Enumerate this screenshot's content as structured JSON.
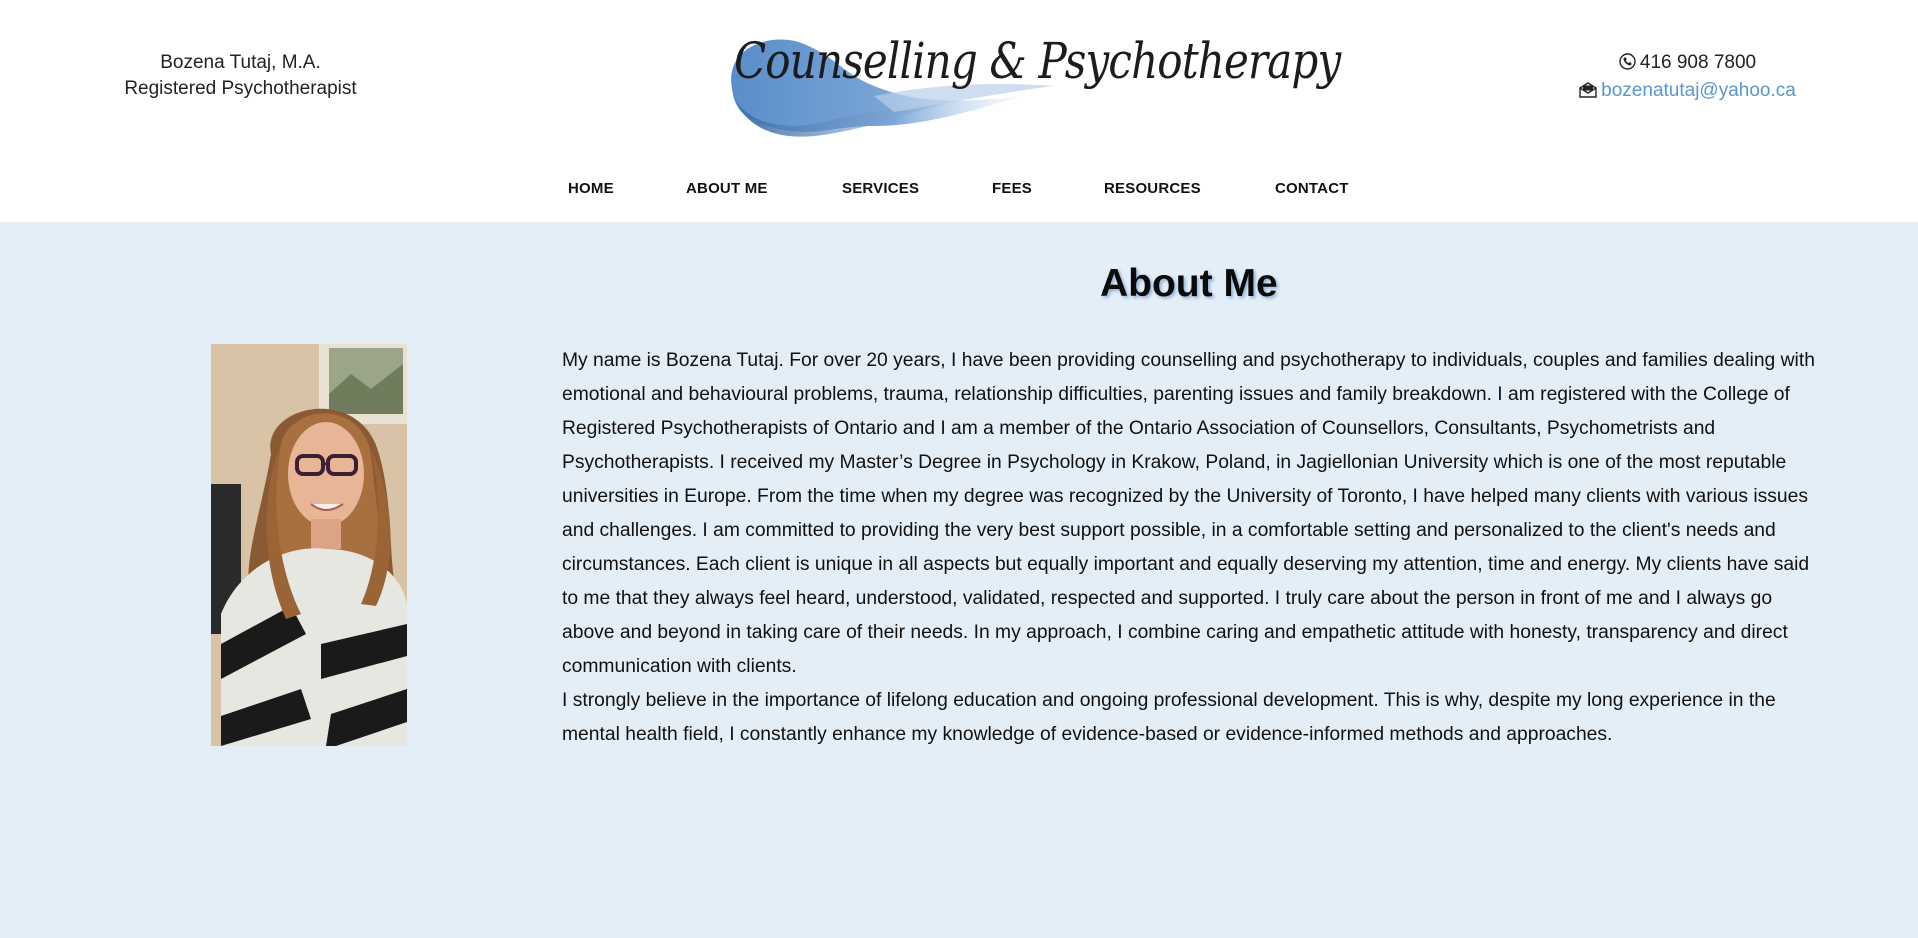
{
  "header": {
    "practitioner_name": "Bozena Tutaj, M.A.",
    "practitioner_title": "Registered Psychotherapist",
    "logo_text": "Counselling & Psychotherapy",
    "phone": "416 908 7800",
    "email": "bozenatutaj@yahoo.ca",
    "phone_icon": "phone-icon",
    "email_icon": "envelope-icon"
  },
  "nav": {
    "items": [
      {
        "label": "HOME"
      },
      {
        "label": "ABOUT ME"
      },
      {
        "label": "SERVICES"
      },
      {
        "label": "FEES"
      },
      {
        "label": "RESOURCES"
      },
      {
        "label": "CONTACT"
      }
    ]
  },
  "main": {
    "title": "About Me",
    "paragraphs": [
      "My name is Bozena Tutaj. For over 20 years, I have been providing counselling and psychotherapy to individuals, couples and families dealing with emotional and behavioural problems, trauma, relationship difficulties, parenting issues and family breakdown. I am registered with the College of Registered Psychotherapists of Ontario and I am a member of the Ontario Association of Counsellors, Consultants, Psychometrists and Psychotherapists. I received my Master’s Degree in Psychology in Krakow, Poland, in Jagiellonian University which is one of the most reputable universities in Europe. From the time when my degree was recognized by the University of Toronto, I have helped many clients with various issues and challenges. I am committed to providing the very best support possible, in a comfortable setting and personalized to the client's needs and circumstances. Each client is unique in all aspects but equally important and equally deserving my attention, time and energy. My clients have said to me that they always feel heard, understood, validated, respected and supported. I truly care about the person in front of me and I always go above and beyond in taking care of their needs. In my approach, I combine caring and empathetic attitude with honesty, transparency and direct communication with clients.",
      "I strongly believe in the importance of lifelong education and ongoing professional development. This is why, despite my long experience in the mental health field, I constantly enhance my knowledge of evidence-based or evidence-informed methods and approaches."
    ]
  },
  "colors": {
    "main_background": "#e4eef6",
    "link": "#5b95d1",
    "logo_swoosh": "#5f92cc",
    "title_shadow": "#8fb3d8"
  }
}
